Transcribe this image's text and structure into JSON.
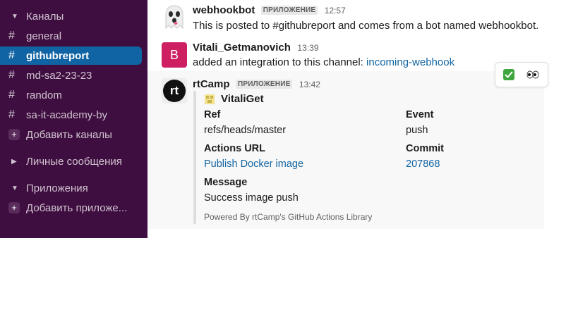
{
  "sidebar": {
    "channels_header": "Каналы",
    "channels": [
      {
        "label": "general"
      },
      {
        "label": "githubreport"
      },
      {
        "label": "md-sa2-23-23"
      },
      {
        "label": "random"
      },
      {
        "label": "sa-it-academy-by"
      }
    ],
    "add_channels": "Добавить каналы",
    "dms_header": "Личные сообщения",
    "apps_header": "Приложения",
    "add_apps": "Добавить приложе..."
  },
  "messages": [
    {
      "author": "webhookbot",
      "badge": "ПРИЛОЖЕНИЕ",
      "time": "12:57",
      "text": "This is posted to #githubreport and comes from a bot named webhookbot."
    },
    {
      "author": "Vitali_Getmanovich",
      "avatar_letter": "B",
      "time": "13:39",
      "text_prefix": "added an integration to this channel: ",
      "link": "incoming-webhook"
    },
    {
      "author": "rtCamp",
      "avatar_text": "rt",
      "badge": "ПРИЛОЖЕНИЕ",
      "time": "13:42",
      "attachment": {
        "author": "VitaliGet",
        "fields": {
          "ref_title": "Ref",
          "ref_value": "refs/heads/master",
          "event_title": "Event",
          "event_value": "push",
          "actions_url_title": "Actions URL",
          "actions_url_value": "Publish Docker image",
          "commit_title": "Commit",
          "commit_value": "207868",
          "message_title": "Message",
          "message_value": "Success image push"
        },
        "footer": "Powered By rtCamp's GitHub Actions Library"
      }
    }
  ],
  "hover_actions": [
    "check-mark-emoji",
    "eyes-emoji"
  ],
  "colors": {
    "sidebar_bg": "#3f0e40",
    "active_channel": "#1164a3",
    "link": "#1264a3"
  }
}
